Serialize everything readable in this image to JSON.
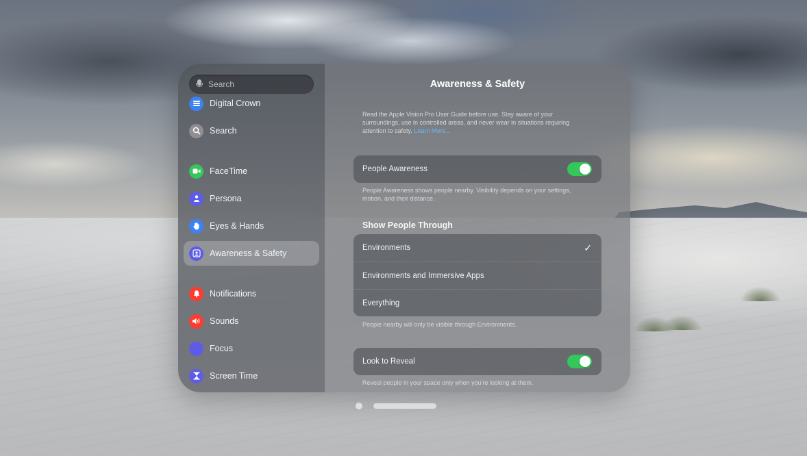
{
  "sidebar": {
    "search_placeholder": "Search",
    "items": [
      {
        "label": "Digital Crown",
        "icon": "digital-crown-icon",
        "color": "#3b82f6"
      },
      {
        "label": "Search",
        "icon": "search-icon",
        "color": "#8e8e93"
      },
      {
        "label": "FaceTime",
        "icon": "facetime-icon",
        "color": "#34c759"
      },
      {
        "label": "Persona",
        "icon": "persona-icon",
        "color": "#5e5ce6"
      },
      {
        "label": "Eyes & Hands",
        "icon": "hand-icon",
        "color": "#3b82f6"
      },
      {
        "label": "Awareness & Safety",
        "icon": "awareness-icon",
        "color": "#5e5ce6",
        "selected": true
      },
      {
        "label": "Notifications",
        "icon": "bell-icon",
        "color": "#ff3b30"
      },
      {
        "label": "Sounds",
        "icon": "speaker-icon",
        "color": "#ff3b30"
      },
      {
        "label": "Focus",
        "icon": "moon-icon",
        "color": "#5e5ce6"
      },
      {
        "label": "Screen Time",
        "icon": "hourglass-icon",
        "color": "#5e5ce6"
      }
    ]
  },
  "content": {
    "title": "Awareness & Safety",
    "intro_text": "Read the Apple Vision Pro User Guide before use. Stay aware of your surroundings, use in controlled areas, and never wear in situations requiring attention to safety.",
    "learn_more": "Learn More...",
    "people_awareness": {
      "label": "People Awareness",
      "enabled": true,
      "footnote": "People Awareness shows people nearby. Visibility depends on your settings, motion, and their distance."
    },
    "show_people_through": {
      "header": "Show People Through",
      "options": [
        "Environments",
        "Environments and Immersive Apps",
        "Everything"
      ],
      "selected": "Environments",
      "check_glyph": "✓",
      "footnote": "People nearby will only be visible through Environments."
    },
    "look_to_reveal": {
      "label": "Look to Reveal",
      "enabled": true,
      "footnote": "Reveal people in your space only when you're looking at them."
    }
  },
  "colors": {
    "toggle_on": "#34c759",
    "link": "#6fb8f2"
  }
}
